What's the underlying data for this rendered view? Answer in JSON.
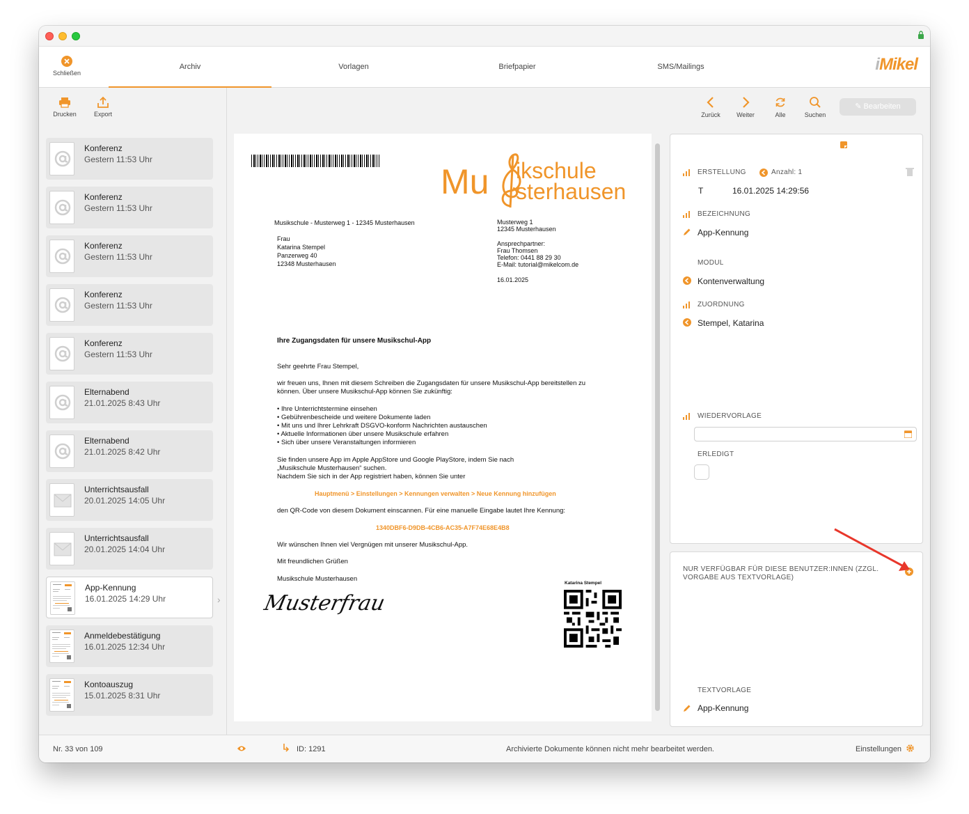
{
  "titlebar": {
    "lock_icon": "lock-icon"
  },
  "topnav": {
    "close_label": "Schließen",
    "tabs": [
      "Archiv",
      "Vorlagen",
      "Briefpapier",
      "SMS/Mailings"
    ],
    "active_tab": "Archiv",
    "logo_prefix": "i",
    "logo_text": "Mikel"
  },
  "sidebar": {
    "print_label": "Drucken",
    "export_label": "Export",
    "items": [
      {
        "title": "Konferenz",
        "time": "Gestern 11:53 Uhr",
        "icon": "at-icon"
      },
      {
        "title": "Konferenz",
        "time": "Gestern 11:53 Uhr",
        "icon": "at-icon"
      },
      {
        "title": "Konferenz",
        "time": "Gestern 11:53 Uhr",
        "icon": "at-icon"
      },
      {
        "title": "Konferenz",
        "time": "Gestern 11:53 Uhr",
        "icon": "at-icon"
      },
      {
        "title": "Konferenz",
        "time": "Gestern 11:53 Uhr",
        "icon": "at-icon"
      },
      {
        "title": "Elternabend",
        "time": "21.01.2025 8:43 Uhr",
        "icon": "at-icon"
      },
      {
        "title": "Elternabend",
        "time": "21.01.2025 8:42 Uhr",
        "icon": "at-icon"
      },
      {
        "title": "Unterrichtsausfall",
        "time": "20.01.2025 14:05 Uhr",
        "icon": "envelope-icon"
      },
      {
        "title": "Unterrichtsausfall",
        "time": "20.01.2025 14:04 Uhr",
        "icon": "envelope-icon"
      },
      {
        "title": "App-Kennung",
        "time": "16.01.2025 14:29 Uhr",
        "icon": "document-thumbnail"
      },
      {
        "title": "Anmeldebestätigung",
        "time": "16.01.2025 12:34 Uhr",
        "icon": "document-thumbnail"
      },
      {
        "title": "Kontoauszug",
        "time": "15.01.2025 8:31 Uhr",
        "icon": "document-thumbnail"
      }
    ]
  },
  "toolbar": {
    "back_label": "Zurück",
    "forward_label": "Weiter",
    "all_label": "Alle",
    "search_label": "Suchen",
    "edit_label": "Bearbeiten"
  },
  "document": {
    "logo_line1": "Mu  ikschule",
    "logo_line2": "Mu  sterhausen",
    "logo_m1": "Mu",
    "logo_r1": "ikschule",
    "logo_r2": "sterhausen",
    "sender_line": "Musikschule - Musterweg 1 - 12345 Musterhausen",
    "recipient": [
      "Frau",
      "Katarina Stempel",
      "Panzerweg 40",
      "12348 Musterhausen"
    ],
    "address_right": [
      "Musterweg 1",
      "12345 Musterhausen"
    ],
    "contact": [
      "Ansprechpartner:",
      "Frau Thomsen",
      "Telefon: 0441 88 29 30",
      "E-Mail: tutorial@mikelcom.de"
    ],
    "date": "16.01.2025",
    "subject": "Ihre Zugangsdaten für unsere Musikschul-App",
    "salutation": "Sehr geehrte Frau Stempel,",
    "intro": [
      "wir freuen uns, Ihnen mit diesem Schreiben die Zugangsdaten für unsere Musikschul-App bereitstellen zu",
      "können. Über unsere Musikschul-App können Sie zukünftig:"
    ],
    "bullets": [
      "• Ihre Unterrichtstermine einsehen",
      "• Gebührenbescheide und weitere Dokumente laden",
      "• Mit uns und Ihrer Lehrkraft DSGVO-konform Nachrichten austauschen",
      "• Aktuelle Informationen über unsere Musikschule erfahren",
      "• Sich über unsere Veranstaltungen informieren"
    ],
    "store_text": [
      "Sie finden unsere App im Apple AppStore und Google PlayStore, indem Sie nach",
      "„Musikschule Musterhausen“ suchen.",
      "Nachdem Sie sich in der App registriert haben, können Sie unter"
    ],
    "menu_path": "Hauptmenü > Einstellungen > Kennungen verwalten > Neue Kennung hinzufügen",
    "qr_text": "den QR-Code von diesem Dokument einscannen. Für eine manuelle Eingabe lautet Ihre Kennung:",
    "code": "1340DBF6-D9DB-4CB6-AC35-A7F74E68E4B8",
    "wish": "Wir wünschen Ihnen viel Vergnügen mit unserer Musikschul-App.",
    "greeting": "Mit freundlichen Grüßen",
    "signer": "Musikschule Musterhausen",
    "signature_text": "Musterfrau",
    "qr_name": "Katarina Stempel"
  },
  "details": {
    "creation_label": "ERSTELLUNG",
    "count_label": "Anzahl: 1",
    "creation_type": "T",
    "creation_date": "16.01.2025 14:29:56",
    "name_label": "BEZEICHNUNG",
    "name_value": "App-Kennung",
    "module_label": "MODUL",
    "module_value": "Kontenverwaltung",
    "assignment_label": "ZUORDNUNG",
    "assignment_value": "Stempel, Katarina",
    "resubmission_label": "WIEDERVORLAGE",
    "resubmission_value": "",
    "done_label": "ERLEDIGT"
  },
  "users": {
    "title": "NUR VERFÜGBAR FÜR DIESE BENUTZER:INNEN (ZZGL. VORGABE AUS TEXTVORLAGE)",
    "template_label": "TEXTVORLAGE",
    "template_value": "App-Kennung"
  },
  "statusbar": {
    "record": "Nr. 33 von 109",
    "id": "ID: 1291",
    "message": "Archivierte Dokumente können nicht mehr bearbeitet werden.",
    "settings": "Einstellungen"
  },
  "colors": {
    "accent": "#f0952a",
    "annotation_arrow": "#e8372b"
  }
}
